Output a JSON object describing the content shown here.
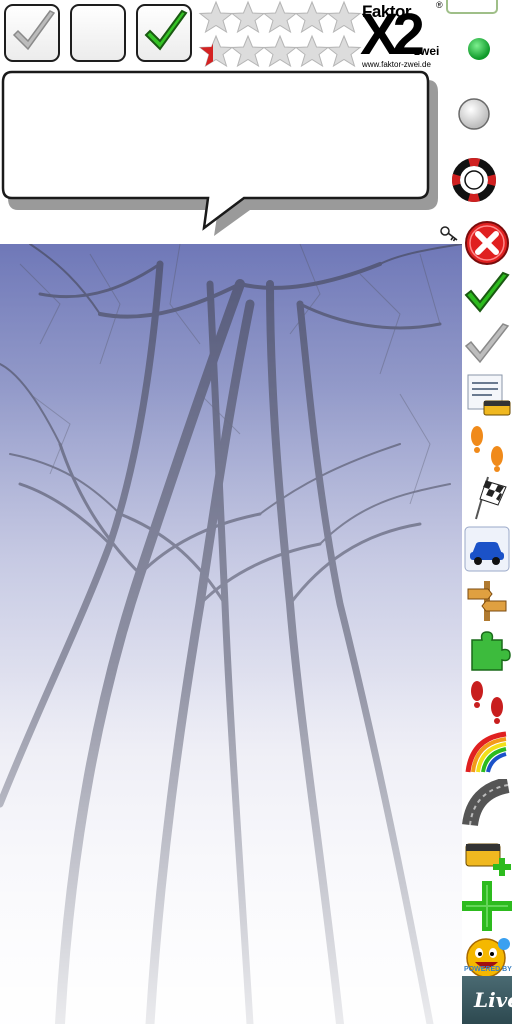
{
  "checkboxes": [
    {
      "name": "checkbox-checked-gray",
      "checked": true,
      "check_color": "#9a9a9a"
    },
    {
      "name": "checkbox-empty",
      "checked": false
    },
    {
      "name": "checkbox-checked-green",
      "checked": true,
      "check_color": "#2dbb1e"
    }
  ],
  "rating": {
    "rows": [
      {
        "filled": 0,
        "total": 5
      },
      {
        "filled": 0,
        "total": 5,
        "partial_first_red": true
      }
    ],
    "star_empty_color": "#dcdcdc",
    "star_partial_color": "#d42222"
  },
  "logo": {
    "faktor": "Faktor",
    "x2": "X2",
    "zwei": "zwei",
    "registered": "®",
    "url": "www.faktor-zwei.de"
  },
  "status_dots": {
    "green_color": "#1eb53a",
    "gray_color": "#d8d8d8"
  },
  "speech_bubble": {
    "text": ""
  },
  "sidebar": {
    "icons": [
      {
        "name": "delete-icon",
        "color": "#e02020"
      },
      {
        "name": "checkmark-green-icon",
        "color": "#2dbb1e"
      },
      {
        "name": "checkmark-gray-icon",
        "color": "#bdbdbd"
      },
      {
        "name": "list-box-icon",
        "color": "#f0b820"
      },
      {
        "name": "footsteps-orange-icon",
        "color": "#f08a1a"
      },
      {
        "name": "checkered-flag-icon",
        "color": "#222222"
      },
      {
        "name": "car-icon",
        "color": "#1b52c8"
      },
      {
        "name": "signpost-icon",
        "color": "#e0a040"
      },
      {
        "name": "puzzle-piece-icon",
        "color": "#3dbb3d"
      },
      {
        "name": "footsteps-red-icon",
        "color": "#c81e1e"
      },
      {
        "name": "rainbow-icon",
        "color": "#e02020"
      },
      {
        "name": "road-curve-icon",
        "color": "#555555"
      },
      {
        "name": "add-box-icon",
        "color": "#f0b820"
      },
      {
        "name": "plus-icon",
        "color": "#2dbb1e"
      },
      {
        "name": "smiley-icon",
        "color": "#f5b800"
      }
    ],
    "powered_by": "POWERED BY",
    "live": "Live"
  },
  "cursor": {
    "name": "key-cursor-icon"
  }
}
